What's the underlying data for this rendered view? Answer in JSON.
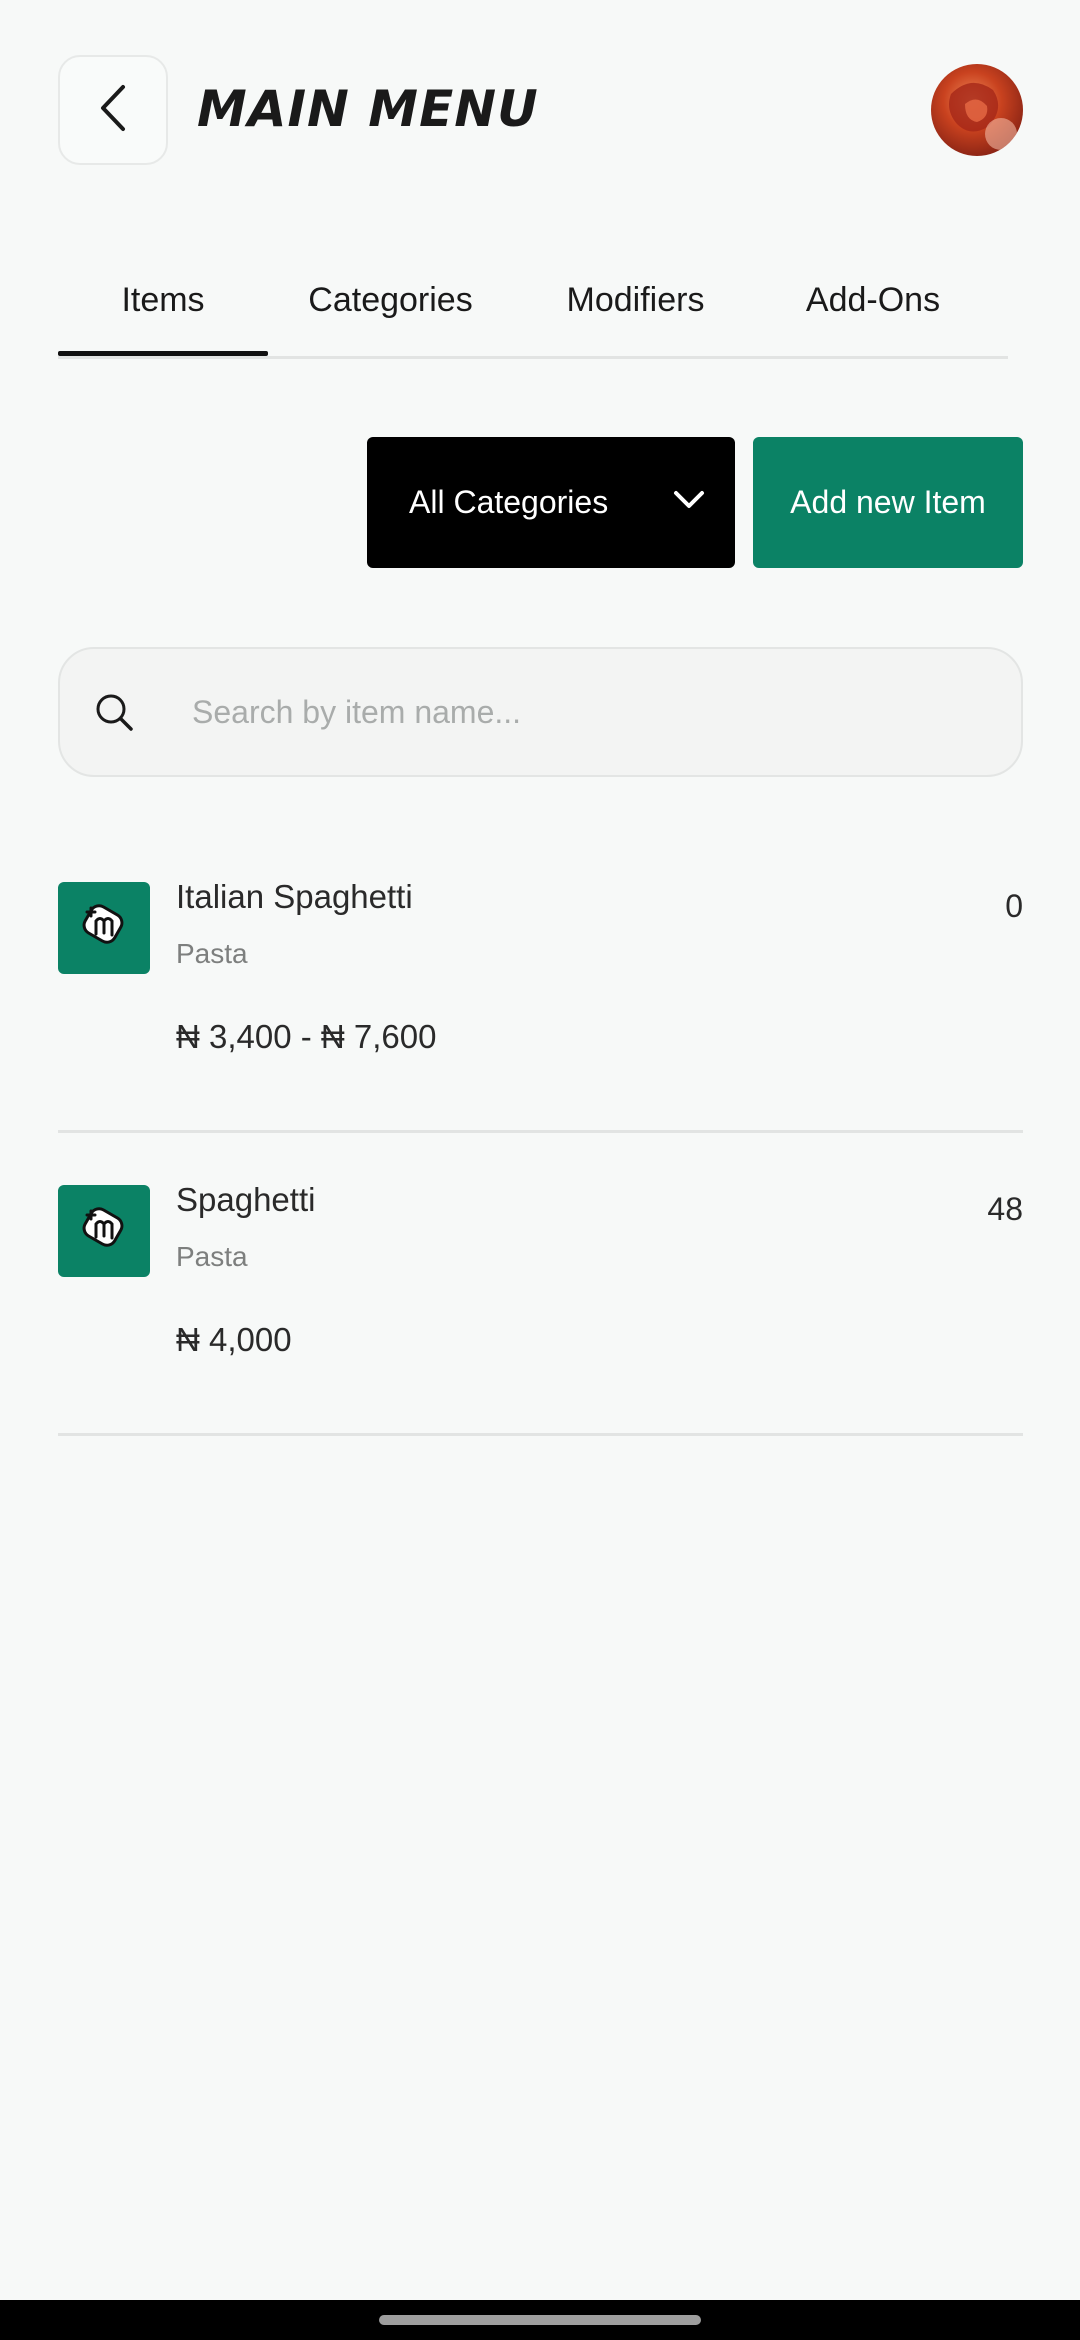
{
  "header": {
    "back_icon": "chevron-left-icon",
    "title": "MAIN MENU",
    "avatar_icon": "user-avatar"
  },
  "tabs": [
    {
      "label": "Items",
      "active": true
    },
    {
      "label": "Categories",
      "active": false
    },
    {
      "label": "Modifiers",
      "active": false
    },
    {
      "label": "Add-Ons",
      "active": false
    }
  ],
  "controls": {
    "category_select": {
      "selected": "All Categories",
      "icon": "chevron-down-icon"
    },
    "add_button_label": "Add new Item"
  },
  "search": {
    "icon": "search-icon",
    "placeholder": "Search by item name...",
    "value": ""
  },
  "items": [
    {
      "name": "Italian Spaghetti",
      "category": "Pasta",
      "price": "₦ 3,400  -  ₦ 7,600",
      "quantity": "0",
      "thumb_icon": "menu-logo-icon"
    },
    {
      "name": "Spaghetti",
      "category": "Pasta",
      "price": "₦ 4,000",
      "quantity": "48",
      "thumb_icon": "menu-logo-icon"
    }
  ],
  "colors": {
    "background": "#f7f9f8",
    "accent": "#0b8265",
    "select_bg": "#000000",
    "divider": "#e2e4e3"
  }
}
